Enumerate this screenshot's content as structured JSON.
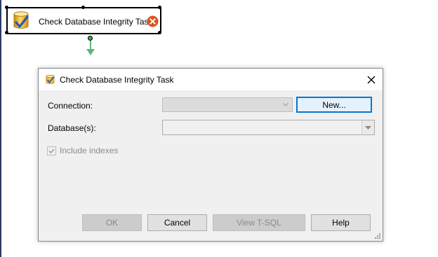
{
  "task_node": {
    "label": "Check Database Integrity Task",
    "icon": "database-check-icon",
    "status_icon": "error-icon"
  },
  "dialog": {
    "title": "Check Database Integrity Task",
    "connection_label": "Connection:",
    "connection_value": "",
    "new_button": "New...",
    "databases_label": "Database(s):",
    "databases_value": "",
    "include_indexes_label": "Include indexes",
    "include_indexes_checked": true,
    "buttons": {
      "ok": "OK",
      "cancel": "Cancel",
      "view_tsql": "View T-SQL",
      "help": "Help"
    }
  },
  "colors": {
    "accent": "#0078d7",
    "error": "#d9541e",
    "connector": "#5bb77a",
    "dialog_bg": "#f0f0f0"
  }
}
